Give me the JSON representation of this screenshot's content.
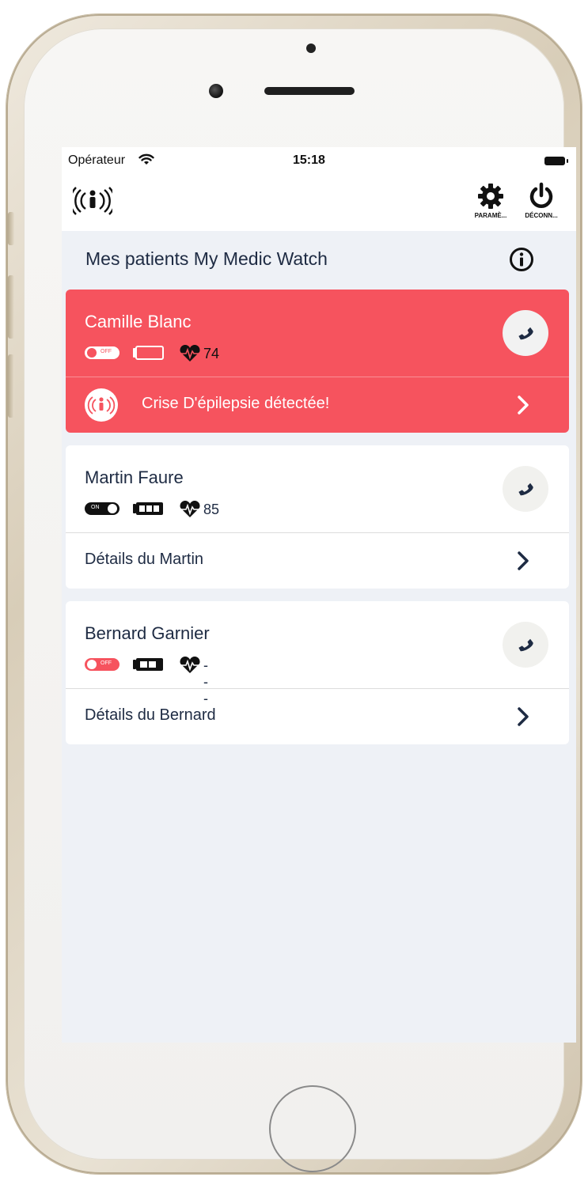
{
  "status_bar": {
    "carrier": "Opérateur",
    "time": "15:18"
  },
  "nav": {
    "settings_label": "PARAMÈ...",
    "logout_label": "DÉCONN..."
  },
  "section": {
    "title": "Mes patients My Medic Watch"
  },
  "patients": [
    {
      "name": "Camille Blanc",
      "toggle": "OFF",
      "heart_rate": "74",
      "alert_text": "Crise D'épilepsie détectée!",
      "card_color": "#f6535e",
      "battery_level": 0
    },
    {
      "name": "Martin Faure",
      "toggle": "ON",
      "heart_rate": "85",
      "detail_text": "Détails du Martin",
      "battery_level": 1
    },
    {
      "name": "Bernard Garnier",
      "toggle": "OFF",
      "heart_rate": "---",
      "detail_text": "Détails du Bernard",
      "battery_level": 0.67
    }
  ],
  "icons": {
    "logo": "person-broadcast-icon",
    "settings": "gear-icon",
    "logout": "power-icon",
    "info": "info-icon",
    "call": "phone-icon",
    "chevron": "chevron-right-icon",
    "heart": "heart-pulse-icon",
    "battery": "battery-icon",
    "wifi": "wifi-icon"
  },
  "colors": {
    "alert_red": "#f6535e",
    "background": "#eef1f6",
    "title_navy": "#1e2b43"
  }
}
